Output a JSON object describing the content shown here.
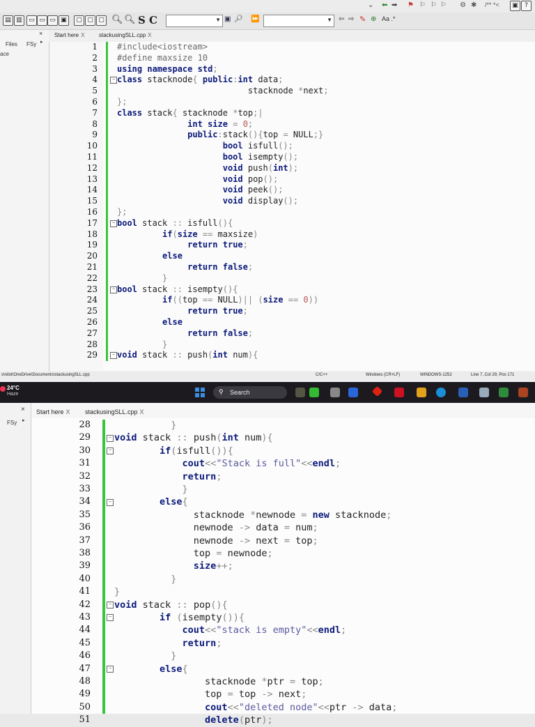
{
  "top": {
    "tabs": [
      {
        "label": "Start here"
      },
      {
        "label": "stackusingSLL.cpp"
      }
    ],
    "side_tabs": {
      "files": "Files",
      "fsy": "FSy",
      "ace": "ace"
    },
    "toolbar_letters": "S C",
    "lines": [
      {
        "n": "1",
        "code": "#include<iostream>"
      },
      {
        "n": "2",
        "code": "#define maxsize 10"
      },
      {
        "n": "3",
        "code": "using namespace std;"
      },
      {
        "n": "4",
        "code": "class stacknode{ public:int data;"
      },
      {
        "n": "5",
        "code": "                          stacknode *next;"
      },
      {
        "n": "6",
        "code": "};"
      },
      {
        "n": "7",
        "code": "class stack{ stacknode *top;|"
      },
      {
        "n": "8",
        "code": "              int size = 0;"
      },
      {
        "n": "9",
        "code": "              public:stack(){top = NULL;}"
      },
      {
        "n": "10",
        "code": "                     bool isfull();"
      },
      {
        "n": "11",
        "code": "                     bool isempty();"
      },
      {
        "n": "12",
        "code": "                     void push(int);"
      },
      {
        "n": "13",
        "code": "                     void pop();"
      },
      {
        "n": "14",
        "code": "                     void peek();"
      },
      {
        "n": "15",
        "code": "                     void display();"
      },
      {
        "n": "16",
        "code": "};"
      },
      {
        "n": "17",
        "code": "bool stack :: isfull(){"
      },
      {
        "n": "18",
        "code": "         if(size == maxsize)"
      },
      {
        "n": "19",
        "code": "              return true;"
      },
      {
        "n": "20",
        "code": "         else"
      },
      {
        "n": "21",
        "code": "              return false;"
      },
      {
        "n": "22",
        "code": "         }"
      },
      {
        "n": "23",
        "code": "bool stack :: isempty(){"
      },
      {
        "n": "24",
        "code": "         if((top == NULL)|| (size == 0))"
      },
      {
        "n": "25",
        "code": "              return true;"
      },
      {
        "n": "26",
        "code": "         else"
      },
      {
        "n": "27",
        "code": "              return false;"
      },
      {
        "n": "28",
        "code": "         }"
      },
      {
        "n": "29",
        "code": "void stack :: push(int num){"
      }
    ],
    "status": {
      "path": "s\\nilot\\OneDrive\\Documents\\stackusingSLL.cpp",
      "lang": "C/C++",
      "eol": "Windows (CR+LF)",
      "enc": "WINDOWS-1252",
      "pos": "Line 7, Col 29, Pos 171"
    }
  },
  "taskbar": {
    "weather_temp": "24°C",
    "weather_desc": "Haze",
    "search_label": "Search",
    "colors": {
      "bg": "#1c1a1f",
      "accent": "#3c8de0"
    }
  },
  "bottom": {
    "tabs": [
      {
        "label": "Start here"
      },
      {
        "label": "stackusingSLL.cpp"
      }
    ],
    "side_tab": "FSy",
    "lines": [
      {
        "n": "28",
        "code": "          }"
      },
      {
        "n": "29",
        "code": "void stack :: push(int num){"
      },
      {
        "n": "30",
        "code": "        if(isfull()){"
      },
      {
        "n": "31",
        "code": "            cout<<\"Stack is full\"<<endl;"
      },
      {
        "n": "32",
        "code": "            return;"
      },
      {
        "n": "33",
        "code": "            }"
      },
      {
        "n": "34",
        "code": "        else{"
      },
      {
        "n": "35",
        "code": "              stacknode *newnode = new stacknode;"
      },
      {
        "n": "36",
        "code": "              newnode -> data = num;"
      },
      {
        "n": "37",
        "code": "              newnode -> next = top;"
      },
      {
        "n": "38",
        "code": "              top = newnode;"
      },
      {
        "n": "39",
        "code": "              size++;"
      },
      {
        "n": "40",
        "code": "          }"
      },
      {
        "n": "41",
        "code": "}"
      },
      {
        "n": "42",
        "code": "void stack :: pop(){"
      },
      {
        "n": "43",
        "code": "        if (isempty()){"
      },
      {
        "n": "44",
        "code": "            cout<<\"stack is empty\"<<endl;"
      },
      {
        "n": "45",
        "code": "            return;"
      },
      {
        "n": "46",
        "code": "          }"
      },
      {
        "n": "47",
        "code": "        else{"
      },
      {
        "n": "48",
        "code": "                stacknode *ptr = top;"
      },
      {
        "n": "49",
        "code": "                top = top -> next;"
      },
      {
        "n": "50",
        "code": "                cout<<\"deleted node\"<<ptr -> data;"
      },
      {
        "n": "51",
        "code": "                delete(ptr);"
      }
    ]
  }
}
